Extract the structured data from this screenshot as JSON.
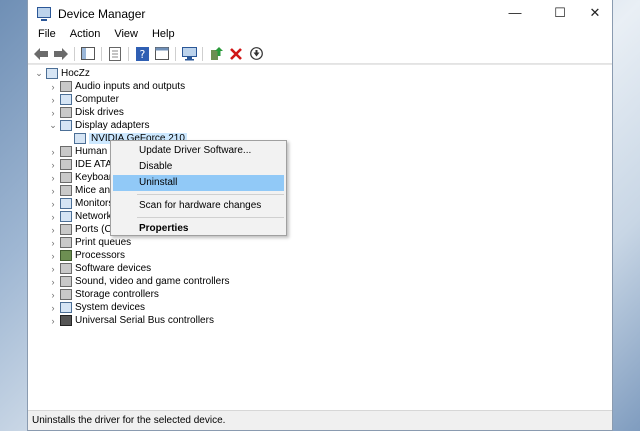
{
  "window": {
    "title": "Device Manager"
  },
  "controls": {
    "minimize": "—",
    "maximize": "☐",
    "close": "✕"
  },
  "menu": [
    "File",
    "Action",
    "View",
    "Help"
  ],
  "tree": {
    "root": "HocZz",
    "items": [
      {
        "label": "Audio inputs and outputs",
        "arrow": "›",
        "icon": "speaker-icon"
      },
      {
        "label": "Computer",
        "arrow": "›",
        "icon": "computer-icon"
      },
      {
        "label": "Disk drives",
        "arrow": "›",
        "icon": "disk-drive-icon"
      },
      {
        "label": "Display adapters",
        "arrow": "⌄",
        "icon": "display-adapter-icon"
      },
      {
        "label": "NVIDIA GeForce 210",
        "arrow": "",
        "icon": "monitor-icon",
        "child": true,
        "selected": true
      },
      {
        "label": "Human I",
        "arrow": "›",
        "icon": "hid-icon"
      },
      {
        "label": "IDE ATA/",
        "arrow": "›",
        "icon": "ide-icon"
      },
      {
        "label": "Keyboar",
        "arrow": "›",
        "icon": "keyboard-icon"
      },
      {
        "label": "Mice and",
        "arrow": "›",
        "icon": "mouse-icon"
      },
      {
        "label": "Monitors",
        "arrow": "›",
        "icon": "monitor-icon"
      },
      {
        "label": "Network",
        "arrow": "›",
        "icon": "network-icon"
      },
      {
        "label": "Ports (CO",
        "arrow": "›",
        "icon": "port-icon"
      },
      {
        "label": "Print queues",
        "arrow": "›",
        "icon": "printer-icon"
      },
      {
        "label": "Processors",
        "arrow": "›",
        "icon": "processor-icon"
      },
      {
        "label": "Software devices",
        "arrow": "›",
        "icon": "software-device-icon"
      },
      {
        "label": "Sound, video and game controllers",
        "arrow": "›",
        "icon": "sound-icon"
      },
      {
        "label": "Storage controllers",
        "arrow": "›",
        "icon": "storage-icon"
      },
      {
        "label": "System devices",
        "arrow": "›",
        "icon": "system-device-icon"
      },
      {
        "label": "Universal Serial Bus controllers",
        "arrow": "›",
        "icon": "usb-icon"
      }
    ]
  },
  "context_menu": {
    "update": "Update Driver Software...",
    "disable": "Disable",
    "uninstall": "Uninstall",
    "scan": "Scan for hardware changes",
    "properties": "Properties"
  },
  "status": "Uninstalls the driver for the selected device."
}
